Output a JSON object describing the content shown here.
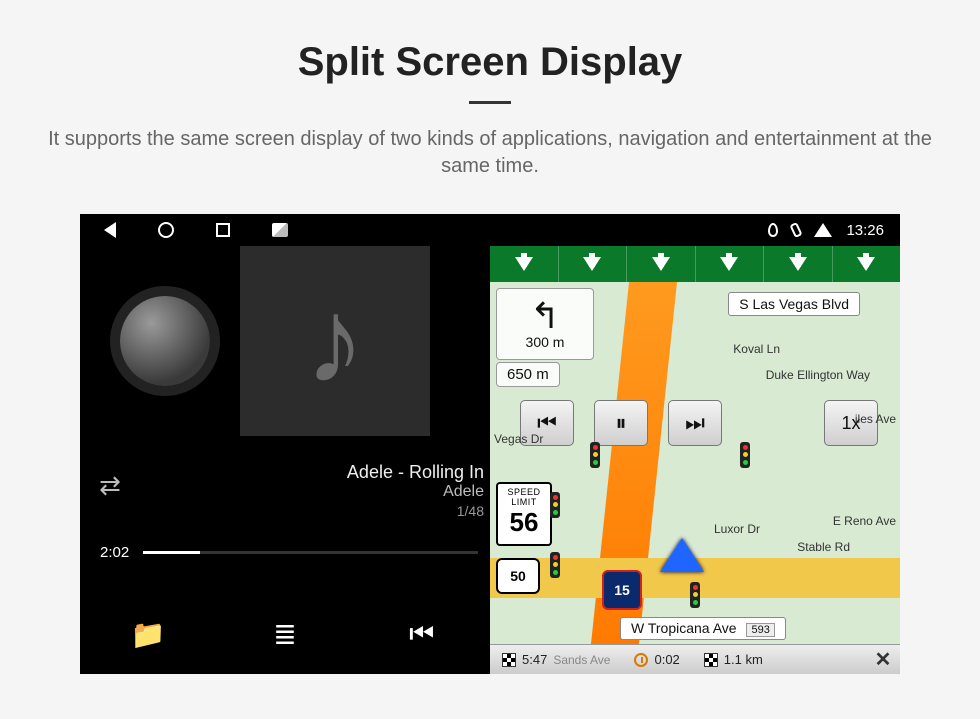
{
  "hero": {
    "title": "Split Screen Display",
    "subtitle": "It supports the same screen display of two kinds of applications, navigation and entertainment at the same time."
  },
  "statusbar": {
    "time": "13:26"
  },
  "music": {
    "elapsed": "2:02",
    "track_title": "Adele - Rolling In",
    "track_artist": "Adele",
    "track_index": "1/48"
  },
  "nav": {
    "turn_dist_small": "300 m",
    "turn_dist_large": "650 m",
    "speed_btn": "1x",
    "speed_limit_label": "SPEED LIMIT",
    "speed_limit_value": "56",
    "highway_number": "50",
    "interstate_number": "15",
    "street_top": "S Las Vegas Blvd",
    "street_bottom": "W Tropicana Ave",
    "street_bottom_badge": "593",
    "label_koval": "Koval Ln",
    "label_duke": "Duke Ellington Way",
    "label_vegas_dr": "Vegas Dr",
    "label_luxor": "Luxor Dr",
    "label_stable": "Stable Rd",
    "label_reno": "E Reno Ave",
    "label_sands": "Sands Ave",
    "label_iles": "iles Ave",
    "status_eta": "5:47",
    "status_time": "0:02",
    "status_dist": "1.1 km"
  }
}
